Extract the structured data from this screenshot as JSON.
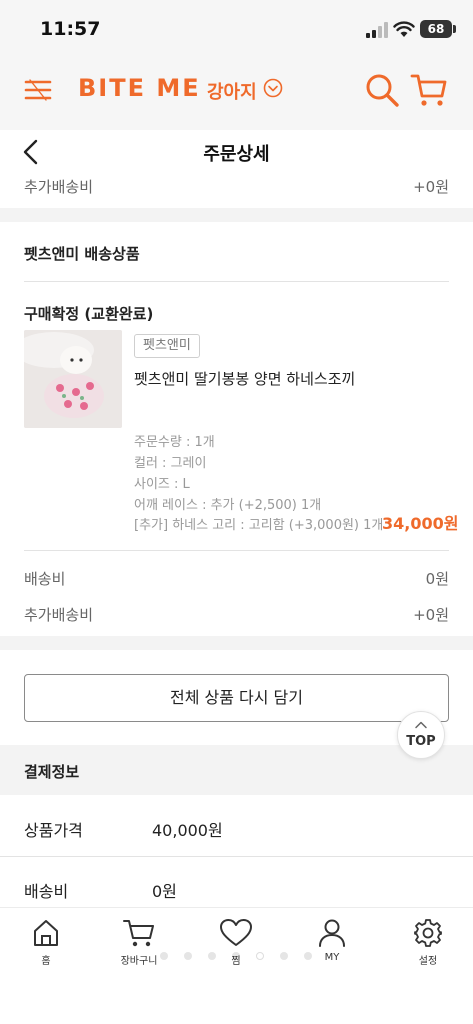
{
  "status_bar": {
    "time": "11:57",
    "battery": "68"
  },
  "header": {
    "logo": "BITE ME",
    "category": "강아지"
  },
  "page": {
    "title": "주문상세"
  },
  "top_summary": {
    "extra_shipping_label": "추가배송비",
    "extra_shipping_value": "+0원"
  },
  "seller_section": {
    "title": "펫츠앤미 배송상품"
  },
  "order_item": {
    "status": "구매확정 (교환완료)",
    "tag": "펫츠앤미",
    "name": "펫츠앤미 딸기봉봉 양면 하네스조끼",
    "options": [
      "주문수량 : 1개",
      "컬러 : 그레이",
      "사이즈 : L",
      "어깨 레이스 : 추가 (+2,500) 1개",
      "[추가] 하네스 고리 : 고리함 (+3,000원) 1개"
    ],
    "price": "34,000원"
  },
  "shipping": {
    "shipping_label": "배송비",
    "shipping_value": "0원",
    "extra_label": "추가배송비",
    "extra_value": "+0원"
  },
  "actions": {
    "redo_label": "전체 상품 다시 담기",
    "top_label": "TOP"
  },
  "payment": {
    "title": "결제정보",
    "rows": [
      {
        "label": "상품가격",
        "value": "40,000원"
      },
      {
        "label": "배송비",
        "value": "0원"
      }
    ]
  },
  "tabbar": {
    "items": [
      {
        "label": "홈",
        "icon": "home-icon"
      },
      {
        "label": "장바구니",
        "icon": "cart-icon"
      },
      {
        "label": "찜",
        "icon": "heart-icon"
      },
      {
        "label": "MY",
        "icon": "user-icon"
      },
      {
        "label": "설정",
        "icon": "gear-icon"
      }
    ]
  },
  "colors": {
    "accent": "#ef6a2b",
    "divider": "#f3f3f3"
  }
}
